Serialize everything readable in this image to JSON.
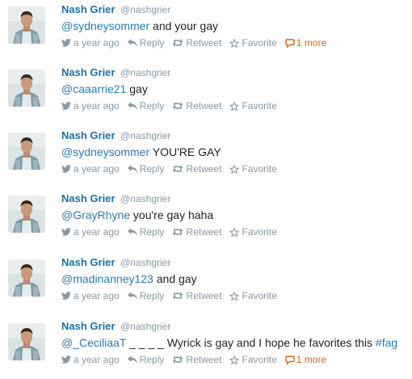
{
  "tweets": [
    {
      "fullname": "Nash Grier",
      "username": "@nashgrier",
      "mention": "@sydneysommer",
      "text": " and your gay",
      "hashtag": "",
      "time": "a year ago",
      "reply": "Reply",
      "retweet": "Retweet",
      "favorite": "Favorite",
      "more": "1 more"
    },
    {
      "fullname": "Nash Grier",
      "username": "@nashgrier",
      "mention": "@caaarrie21",
      "text": " gay",
      "hashtag": "",
      "time": "a year ago",
      "reply": "Reply",
      "retweet": "Retweet",
      "favorite": "Favorite",
      "more": ""
    },
    {
      "fullname": "Nash Grier",
      "username": "@nashgrier",
      "mention": "@sydneysommer",
      "text": " YOU'RE GAY",
      "hashtag": "",
      "time": "a year ago",
      "reply": "Reply",
      "retweet": "Retweet",
      "favorite": "Favorite",
      "more": ""
    },
    {
      "fullname": "Nash Grier",
      "username": "@nashgrier",
      "mention": "@GrayRhyne",
      "text": " you're gay haha",
      "hashtag": "",
      "time": "a year ago",
      "reply": "Reply",
      "retweet": "Retweet",
      "favorite": "Favorite",
      "more": ""
    },
    {
      "fullname": "Nash Grier",
      "username": "@nashgrier",
      "mention": "@madinanney123",
      "text": " and gay",
      "hashtag": "",
      "time": "a year ago",
      "reply": "Reply",
      "retweet": "Retweet",
      "favorite": "Favorite",
      "more": ""
    },
    {
      "fullname": "Nash Grier",
      "username": "@nashgrier",
      "mention": "@_CeciliaaT",
      "text": " _ _ _ _ Wyrick is gay and I hope he favorites this ",
      "hashtag": "#fag",
      "time": "a year ago",
      "reply": "Reply",
      "retweet": "Retweet",
      "favorite": "Favorite",
      "more": "1 more"
    }
  ],
  "colors": {
    "name": "#1f6faa",
    "link": "#2a7ab6",
    "meta": "#8899a6",
    "more": "#d7621a"
  },
  "icons": {
    "bird": "bird-icon",
    "reply": "reply-arrow-icon",
    "retweet": "retweet-icon",
    "favorite": "star-icon",
    "more": "conversation-bubble-icon"
  }
}
